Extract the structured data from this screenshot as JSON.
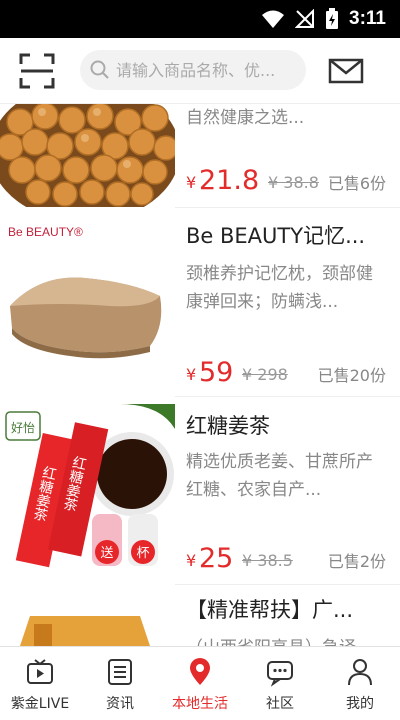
{
  "status_bar": {
    "time": "3:11"
  },
  "search": {
    "placeholder": "请输入商品名称、优..."
  },
  "products": [
    {
      "desc": "自然健康之选...",
      "currency": "¥",
      "price": "21.8",
      "original_price": "¥ 38.8",
      "sold": "已售6份",
      "image": "peanut-snack"
    },
    {
      "title": "Be BEAUTY记忆...",
      "desc": "颈椎养护记忆枕，颈部健康弹回来；防螨浅...",
      "currency": "¥",
      "price": "59",
      "original_price": "¥ 298",
      "sold": "已售20份",
      "brand_logo": "Be BEAUTY®",
      "image": "memory-pillow"
    },
    {
      "title": "红糖姜茶",
      "desc": "精选优质老姜、甘蔗所产红糖、农家自产...",
      "currency": "¥",
      "price": "25",
      "original_price": "¥ 38.5",
      "sold": "已售2份",
      "package_text": "红糖姜茶",
      "brand_logo": "好怡",
      "gift_labels": [
        "送",
        "杯"
      ],
      "image": "ginger-tea"
    },
    {
      "title": "【精准帮扶】广...",
      "desc": "（山西省阳高县）急译",
      "image": "packaged-goods"
    }
  ],
  "tabbar": [
    {
      "label": "紫金LIVE",
      "icon": "tv-play-icon"
    },
    {
      "label": "资讯",
      "icon": "news-list-icon"
    },
    {
      "label": "本地生活",
      "icon": "location-pin-icon",
      "active": true
    },
    {
      "label": "社区",
      "icon": "chat-bubble-icon"
    },
    {
      "label": "我的",
      "icon": "person-icon"
    }
  ],
  "colors": {
    "accent": "#e32b2b",
    "status_bar": "#000000",
    "text": "#222222",
    "muted": "#888888"
  }
}
